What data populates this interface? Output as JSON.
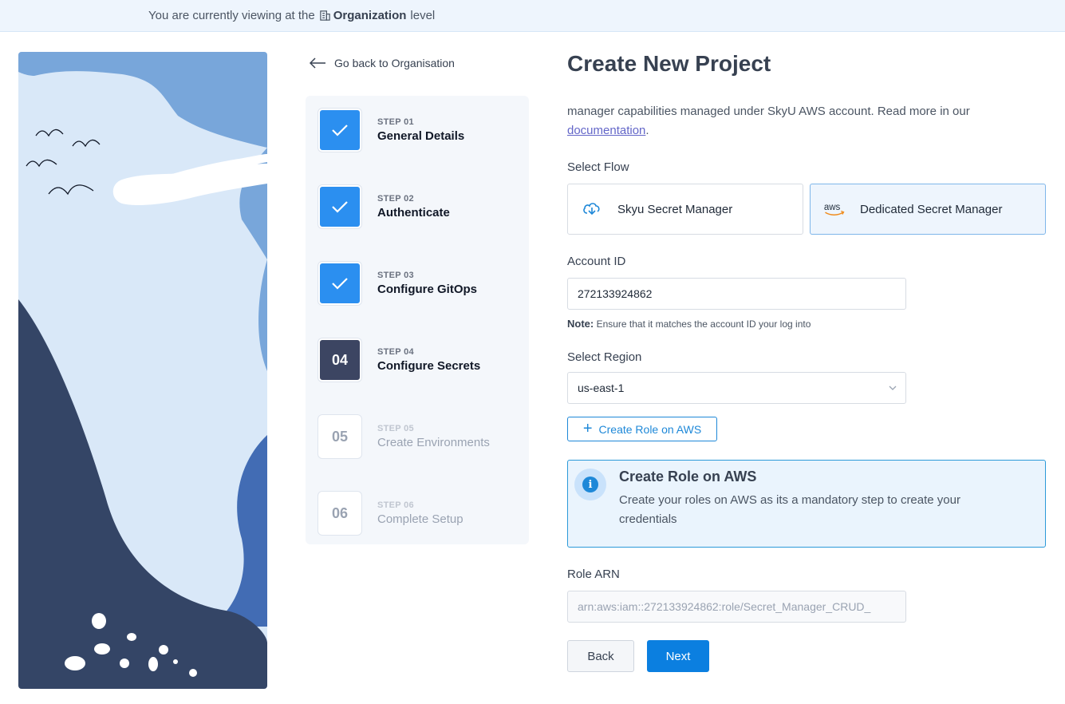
{
  "banner": {
    "prefix": "You are currently viewing at the",
    "level_name": "Organization",
    "suffix": "level",
    "icon": "building-icon"
  },
  "nav": {
    "back_label": "Go back to Organisation",
    "back_icon": "arrow-left-icon"
  },
  "stepper": {
    "steps": [
      {
        "number": "STEP 01",
        "label": "General Details",
        "status": "done",
        "badge": ""
      },
      {
        "number": "STEP 02",
        "label": "Authenticate",
        "status": "done",
        "badge": ""
      },
      {
        "number": "STEP 03",
        "label": "Configure GitOps",
        "status": "done",
        "badge": ""
      },
      {
        "number": "STEP 04",
        "label": "Configure Secrets",
        "status": "current",
        "badge": "04"
      },
      {
        "number": "STEP 05",
        "label": "Create Environments",
        "status": "todo",
        "badge": "05"
      },
      {
        "number": "STEP 06",
        "label": "Complete Setup",
        "status": "todo",
        "badge": "06"
      }
    ]
  },
  "page": {
    "title": "Create New Project",
    "description_text": "manager capabilities managed under SkyU AWS account. Read more in our",
    "description_link": "documentation",
    "description_end": "."
  },
  "flow": {
    "label": "Select Flow",
    "options": [
      {
        "label": "Skyu Secret Manager",
        "icon": "skyu-cloud-icon",
        "selected": false
      },
      {
        "label": "Dedicated Secret Manager",
        "icon": "aws-logo-icon",
        "selected": true
      }
    ]
  },
  "account": {
    "label": "Account ID",
    "value": "272133924862",
    "note_label": "Note:",
    "note_text": "Ensure that it matches the account ID your log into"
  },
  "region": {
    "label": "Select Region",
    "value": "us-east-1"
  },
  "create_role": {
    "button_label": "Create Role on AWS",
    "info_title": "Create Role on AWS",
    "info_text": "Create your roles on AWS as its a mandatory step to create your credentials"
  },
  "role_arn": {
    "label": "Role ARN",
    "value": "arn:aws:iam::272133924862:role/Secret_Manager_CRUD_"
  },
  "actions": {
    "back_label": "Back",
    "next_label": "Next"
  },
  "colors": {
    "primary": "#0b7fe0",
    "step_done": "#2b8ff0",
    "step_current": "#3c4562",
    "info_border": "#2b9ad9"
  }
}
